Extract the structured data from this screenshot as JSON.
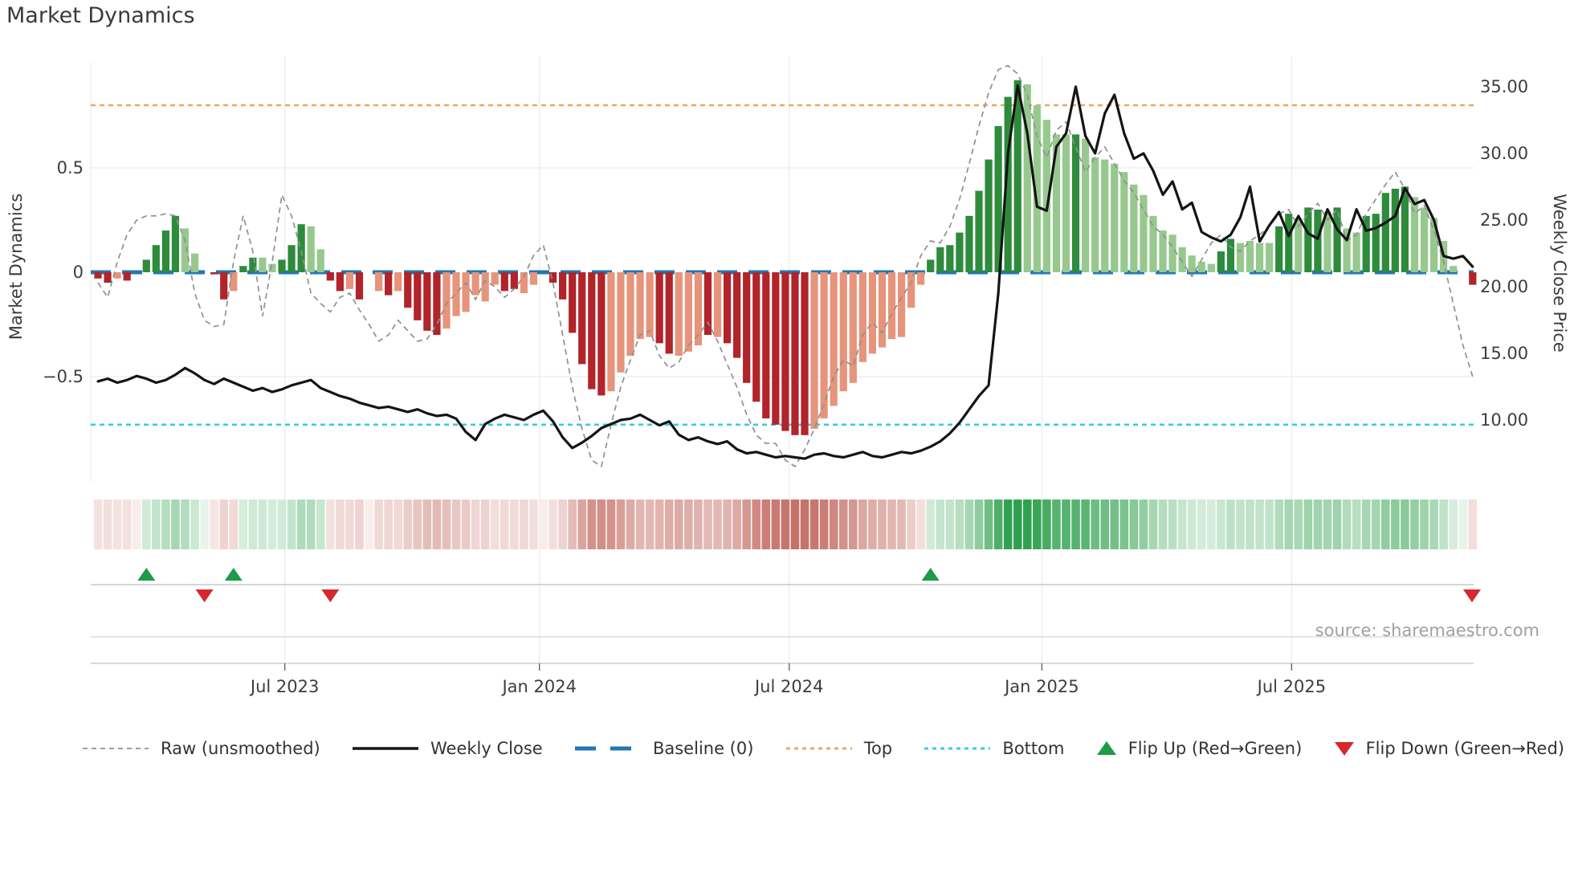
{
  "title": "Market Dynamics",
  "source_credit": "source: sharemaestro.com",
  "left_axis_title": "Market Dynamics",
  "right_axis_title": "Weekly Close Price",
  "legend": {
    "items": [
      {
        "label": "Raw (unsmoothed)"
      },
      {
        "label": "Weekly Close"
      },
      {
        "label": "Baseline (0)"
      },
      {
        "label": "Top"
      },
      {
        "label": "Bottom"
      },
      {
        "label": "Flip Up (Red→Green)"
      },
      {
        "label": "Flip Down (Green→Red)"
      }
    ]
  },
  "colors": {
    "bar_dark_green": "#2e8b3c",
    "bar_light_green": "#97c98e",
    "bar_dark_red": "#b0242a",
    "bar_salmon": "#e6947c",
    "baseline_blue": "#1f77b4",
    "top_orange": "#f3a45f",
    "bottom_cyan": "#3ec7e6",
    "raw_gray": "#909090",
    "price_black": "#141414",
    "marker_green": "#1e9b47",
    "marker_red": "#d7282d",
    "heat_green_base": [
      47,
      161,
      78
    ],
    "heat_red_base": [
      194,
      104,
      94
    ]
  },
  "chart_data": {
    "type": "bar+line combo with heatmap strip and flip markers",
    "title": "Market Dynamics",
    "ylabel_left": "Market Dynamics",
    "ylabel_right": "Weekly Close Price",
    "baseline": 0,
    "top_level": 0.8,
    "bottom_level": -0.73,
    "left_ylim": [
      -1.05,
      1.05
    ],
    "right_ylim_ticks": [
      35,
      30,
      25,
      20,
      15,
      10
    ],
    "left_axis_ticks": [
      {
        "label": "0.5",
        "v": 0.5
      },
      {
        "label": "0",
        "v": 0
      },
      {
        "label": "−0.5",
        "v": -0.5
      }
    ],
    "right_axis_ticks": [
      {
        "label": "35.00",
        "p": 35
      },
      {
        "label": "30.00",
        "p": 30
      },
      {
        "label": "25.00",
        "p": 25
      },
      {
        "label": "20.00",
        "p": 20
      },
      {
        "label": "15.00",
        "p": 15
      },
      {
        "label": "10.00",
        "p": 10
      }
    ],
    "x_axis_ticks": [
      {
        "label": "Jul 2023",
        "week": 19.3
      },
      {
        "label": "Jan 2024",
        "week": 45.6
      },
      {
        "label": "Jul 2024",
        "week": 71.4
      },
      {
        "label": "Jan 2025",
        "week": 97.5
      },
      {
        "label": "Jul 2025",
        "week": 123.3
      }
    ],
    "flip_up_weeks": [
      5,
      14,
      86
    ],
    "flip_down_weeks": [
      11,
      24,
      142
    ],
    "series_notes": "143 weekly points, ~Feb 2023 to ~Nov 2025. v=smoothed oscillator bars, c=bar color class (dg dark green, lg light green, dr dark red, sr salmon, empty=no bar), raw=unsmoothed gray dashed line, price=weekly close (right axis)",
    "v": [
      -0.03,
      -0.05,
      -0.03,
      -0.04,
      0,
      0.06,
      0.13,
      0.2,
      0.27,
      0.21,
      0.09,
      0,
      -0.01,
      -0.13,
      -0.09,
      0.03,
      0.07,
      0.07,
      0.04,
      0.06,
      0.13,
      0.23,
      0.22,
      0.11,
      -0.04,
      -0.09,
      -0.08,
      -0.13,
      0,
      -0.09,
      -0.11,
      -0.09,
      -0.17,
      -0.23,
      -0.28,
      -0.3,
      -0.27,
      -0.21,
      -0.19,
      -0.11,
      -0.14,
      -0.06,
      -0.09,
      -0.08,
      -0.1,
      -0.06,
      0,
      -0.05,
      -0.13,
      -0.29,
      -0.44,
      -0.56,
      -0.59,
      -0.57,
      -0.48,
      -0.4,
      -0.32,
      -0.31,
      -0.34,
      -0.39,
      -0.4,
      -0.38,
      -0.35,
      -0.3,
      -0.31,
      -0.34,
      -0.41,
      -0.53,
      -0.62,
      -0.7,
      -0.73,
      -0.76,
      -0.78,
      -0.78,
      -0.75,
      -0.7,
      -0.64,
      -0.57,
      -0.53,
      -0.43,
      -0.39,
      -0.36,
      -0.32,
      -0.31,
      -0.17,
      -0.06,
      0.06,
      0.12,
      0.13,
      0.19,
      0.27,
      0.39,
      0.54,
      0.7,
      0.84,
      0.92,
      0.9,
      0.8,
      0.73,
      0.66,
      0.66,
      0.66,
      0.64,
      0.55,
      0.54,
      0.52,
      0.48,
      0.42,
      0.37,
      0.27,
      0.2,
      0.18,
      0.12,
      0.08,
      0.05,
      0.04,
      0.1,
      0.16,
      0.14,
      0.15,
      0.14,
      0.14,
      0.22,
      0.28,
      0.26,
      0.31,
      0.3,
      0.29,
      0.31,
      0.21,
      0.19,
      0.27,
      0.28,
      0.38,
      0.4,
      0.41,
      0.36,
      0.31,
      0.26,
      0.15,
      0.03,
      0,
      -0.06
    ],
    "c": [
      "dr",
      "dr",
      "sr",
      "dr",
      "",
      "dg",
      "dg",
      "dg",
      "dg",
      "lg",
      "lg",
      "",
      "dr",
      "dr",
      "sr",
      "dg",
      "dg",
      "lg",
      "lg",
      "dg",
      "dg",
      "dg",
      "lg",
      "lg",
      "dr",
      "dr",
      "sr",
      "dr",
      "",
      "sr",
      "dr",
      "sr",
      "dr",
      "dr",
      "dr",
      "dr",
      "sr",
      "sr",
      "sr",
      "sr",
      "sr",
      "sr",
      "dr",
      "dr",
      "sr",
      "sr",
      "",
      "dr",
      "dr",
      "dr",
      "dr",
      "dr",
      "dr",
      "sr",
      "sr",
      "sr",
      "sr",
      "sr",
      "dr",
      "dr",
      "sr",
      "sr",
      "sr",
      "dr",
      "sr",
      "dr",
      "dr",
      "dr",
      "dr",
      "dr",
      "dr",
      "dr",
      "dr",
      "dr",
      "sr",
      "sr",
      "sr",
      "sr",
      "sr",
      "sr",
      "sr",
      "sr",
      "sr",
      "sr",
      "sr",
      "sr",
      "dg",
      "dg",
      "dg",
      "dg",
      "dg",
      "dg",
      "dg",
      "dg",
      "dg",
      "dg",
      "lg",
      "lg",
      "lg",
      "lg",
      "lg",
      "dg",
      "lg",
      "lg",
      "lg",
      "lg",
      "lg",
      "lg",
      "lg",
      "lg",
      "lg",
      "lg",
      "lg",
      "lg",
      "lg",
      "lg",
      "dg",
      "dg",
      "lg",
      "lg",
      "lg",
      "lg",
      "dg",
      "dg",
      "lg",
      "dg",
      "dg",
      "lg",
      "dg",
      "lg",
      "lg",
      "dg",
      "dg",
      "dg",
      "dg",
      "dg",
      "lg",
      "lg",
      "lg",
      "lg",
      "lg",
      "",
      "dr"
    ],
    "raw": [
      -0.05,
      -0.12,
      0.05,
      0.18,
      0.25,
      0.27,
      0.27,
      0.28,
      0.27,
      0.15,
      -0.1,
      -0.23,
      -0.26,
      -0.25,
      0.05,
      0.27,
      0.1,
      -0.21,
      0.05,
      0.37,
      0.27,
      0.1,
      -0.1,
      -0.15,
      -0.19,
      -0.12,
      -0.1,
      -0.18,
      -0.25,
      -0.33,
      -0.3,
      -0.23,
      -0.28,
      -0.33,
      -0.32,
      -0.25,
      -0.15,
      -0.1,
      -0.05,
      -0.13,
      -0.04,
      -0.07,
      -0.12,
      -0.08,
      -0.02,
      0.08,
      0.13,
      -0.05,
      -0.3,
      -0.55,
      -0.75,
      -0.9,
      -0.93,
      -0.73,
      -0.55,
      -0.42,
      -0.3,
      -0.28,
      -0.4,
      -0.46,
      -0.43,
      -0.35,
      -0.3,
      -0.24,
      -0.33,
      -0.44,
      -0.55,
      -0.68,
      -0.78,
      -0.82,
      -0.82,
      -0.9,
      -0.93,
      -0.85,
      -0.75,
      -0.63,
      -0.5,
      -0.42,
      -0.45,
      -0.3,
      -0.24,
      -0.29,
      -0.2,
      -0.12,
      -0.05,
      0.08,
      0.15,
      0.14,
      0.22,
      0.35,
      0.52,
      0.7,
      0.86,
      0.97,
      0.99,
      0.95,
      0.85,
      0.65,
      0.55,
      0.68,
      0.72,
      0.6,
      0.48,
      0.55,
      0.6,
      0.52,
      0.44,
      0.38,
      0.3,
      0.22,
      0.18,
      0.12,
      0.05,
      -0.02,
      0.06,
      0.14,
      0.18,
      0.12,
      0.1,
      0.15,
      0.18,
      0.22,
      0.28,
      0.3,
      0.22,
      0.28,
      0.33,
      0.25,
      0.3,
      0.15,
      0.18,
      0.28,
      0.35,
      0.42,
      0.48,
      0.4,
      0.28,
      0.32,
      0.2,
      0.05,
      -0.15,
      -0.35,
      -0.5
    ],
    "price": [
      12.9,
      13.1,
      12.8,
      13.0,
      13.3,
      13.1,
      12.8,
      13.0,
      13.4,
      13.9,
      13.5,
      13.0,
      12.7,
      13.1,
      12.8,
      12.5,
      12.2,
      12.4,
      12.1,
      12.3,
      12.6,
      12.8,
      13.0,
      12.4,
      12.1,
      11.8,
      11.6,
      11.3,
      11.1,
      10.9,
      11.0,
      10.8,
      10.6,
      10.8,
      10.5,
      10.3,
      10.4,
      10.1,
      9.1,
      8.5,
      9.7,
      10.1,
      10.4,
      10.2,
      10.0,
      10.4,
      10.7,
      9.9,
      8.7,
      7.9,
      8.3,
      8.8,
      9.4,
      9.7,
      10.0,
      10.1,
      10.4,
      10.0,
      9.6,
      9.9,
      8.9,
      8.5,
      8.7,
      8.4,
      8.2,
      8.4,
      7.8,
      7.5,
      7.6,
      7.4,
      7.2,
      7.3,
      7.2,
      7.1,
      7.4,
      7.5,
      7.3,
      7.2,
      7.4,
      7.6,
      7.3,
      7.2,
      7.4,
      7.6,
      7.5,
      7.7,
      8.0,
      8.4,
      9.0,
      9.8,
      10.8,
      11.8,
      12.6,
      19.5,
      30.0,
      35.1,
      31.5,
      26.0,
      25.7,
      30.5,
      31.5,
      35.0,
      31.3,
      30.0,
      33.0,
      34.4,
      31.5,
      29.6,
      30.0,
      28.7,
      26.9,
      27.9,
      25.8,
      26.3,
      24.1,
      23.7,
      23.4,
      23.9,
      25.2,
      27.5,
      23.4,
      24.6,
      25.6,
      23.8,
      25.3,
      24.0,
      23.6,
      25.8,
      24.3,
      23.5,
      25.8,
      24.2,
      24.4,
      24.8,
      25.3,
      27.4,
      26.2,
      26.5,
      25.0,
      22.3,
      22.1,
      22.3,
      21.5
    ]
  }
}
